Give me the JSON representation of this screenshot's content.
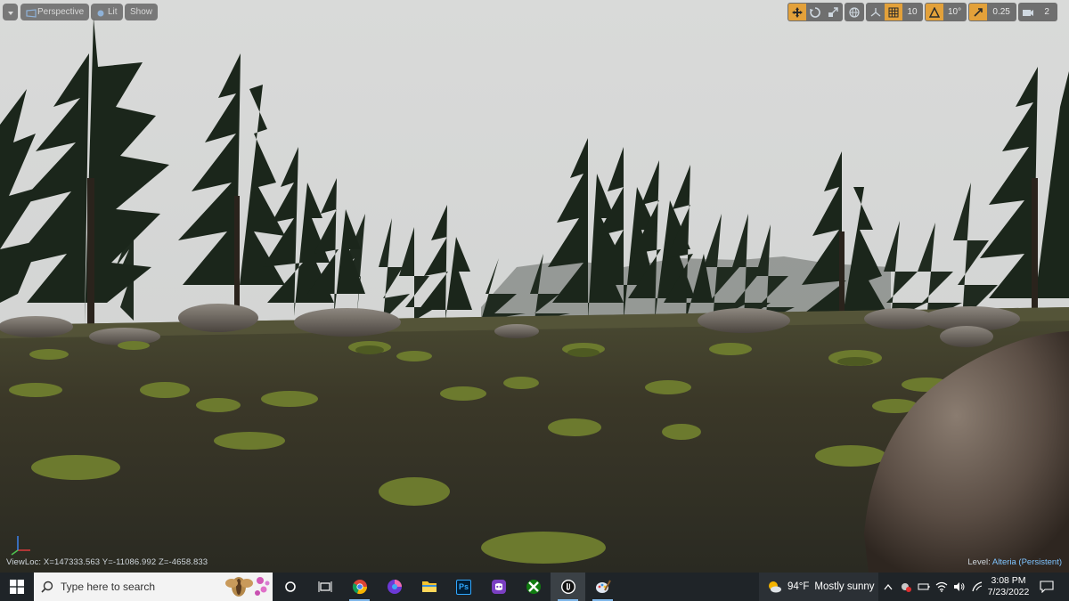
{
  "viewport": {
    "left_buttons": [
      {
        "label": "",
        "icon": "chevron-down-icon"
      },
      {
        "label": "Perspective",
        "icon": "perspective-icon"
      },
      {
        "label": "Lit",
        "icon": "lit-icon"
      },
      {
        "label": "Show",
        "icon": ""
      }
    ],
    "grid_snap": "10",
    "rotation_snap": "10°",
    "scale_snap": "0.25",
    "camera_speed": "2",
    "view_location": "ViewLoc: X=147333.563 Y=-11086.992 Z=-4658.833",
    "level_label": "Level:",
    "level_name": "Alteria (Persistent)"
  },
  "taskbar": {
    "search_placeholder": "Type here to search",
    "apps": [
      {
        "name": "task-view"
      },
      {
        "name": "chrome"
      },
      {
        "name": "firefox-dev"
      },
      {
        "name": "file-explorer"
      },
      {
        "name": "photoshop",
        "label": "Ps"
      },
      {
        "name": "discord"
      },
      {
        "name": "xbox"
      },
      {
        "name": "unreal-engine"
      },
      {
        "name": "paint"
      }
    ],
    "weather_temp": "94°F",
    "weather_text": "Mostly sunny",
    "time": "3:08 PM",
    "date": "7/23/2022"
  },
  "colors": {
    "accent_orange": "#e3a13a",
    "level_blue": "#7fc4ff",
    "taskbar_bg": "#1f2428"
  }
}
